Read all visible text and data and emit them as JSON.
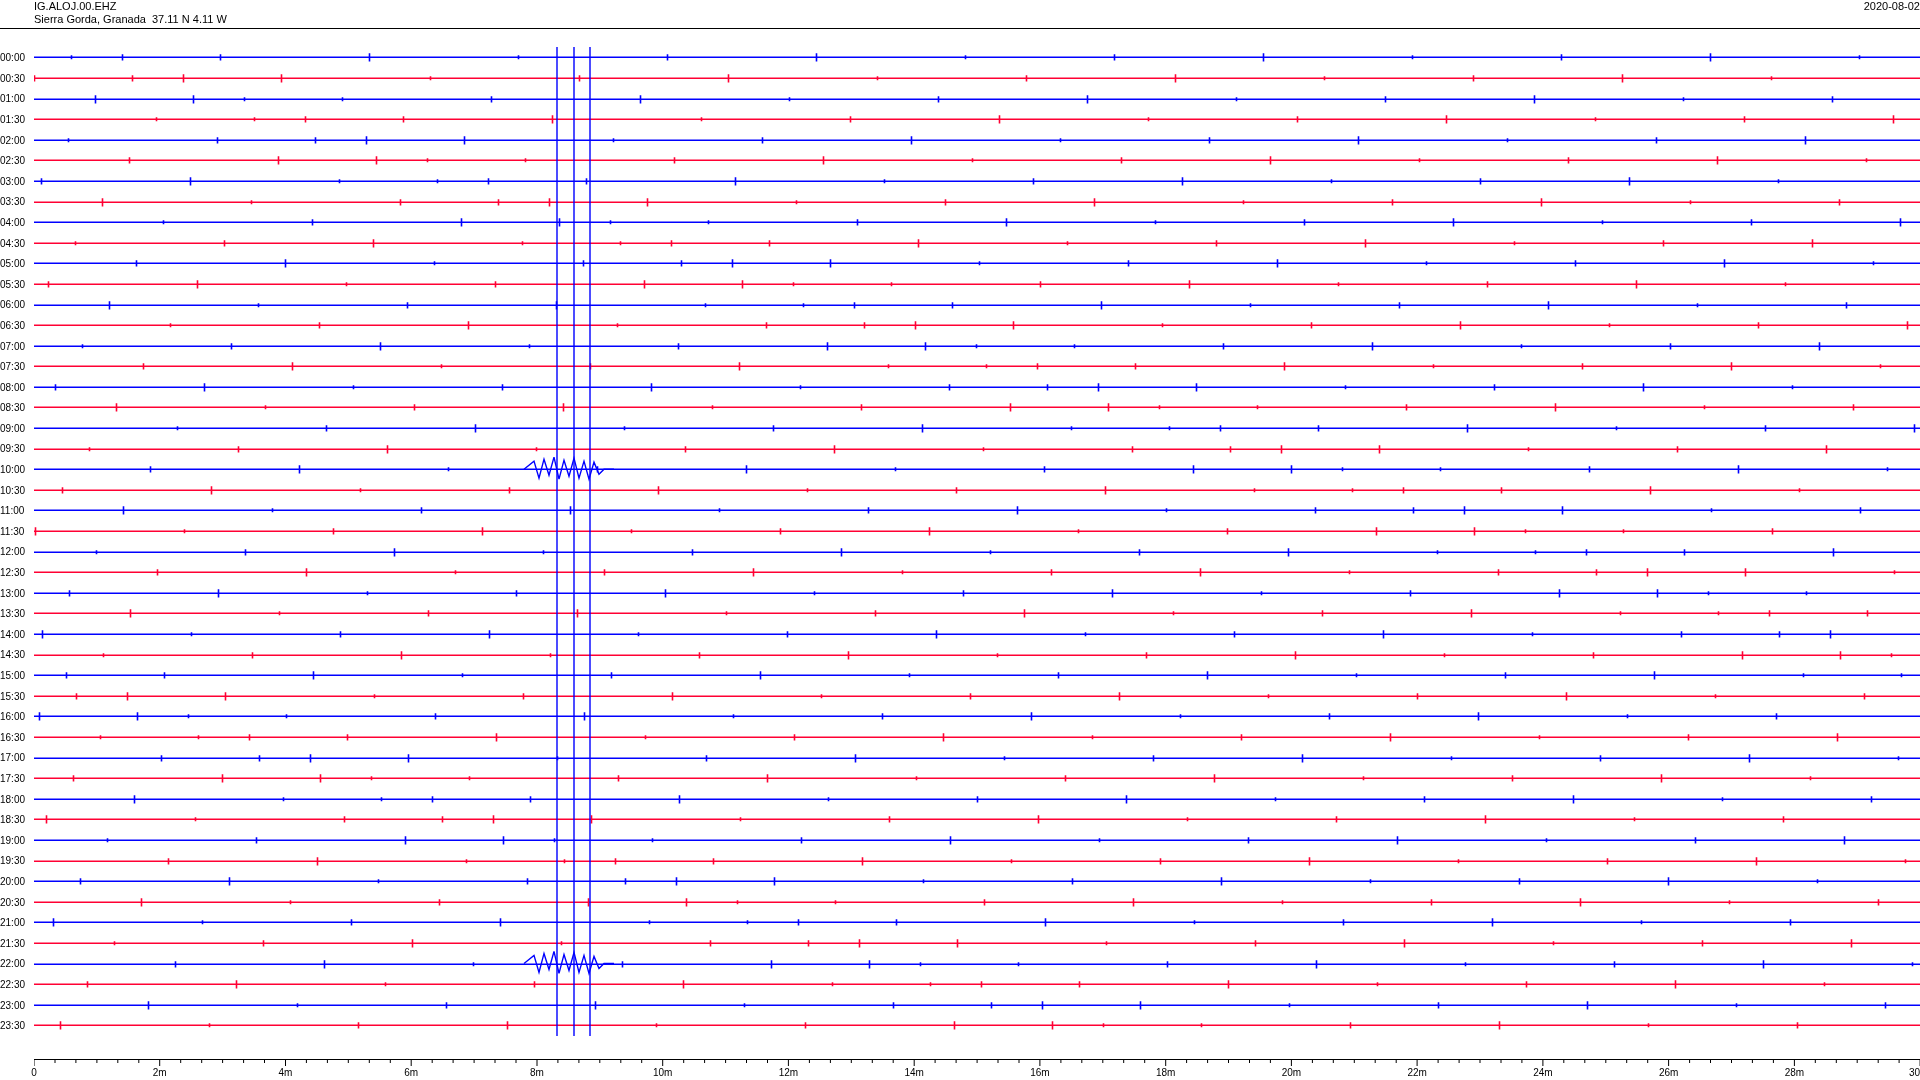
{
  "header": {
    "station": "IG.ALOJ.00.EHZ",
    "location": "Sierra Gorda, Granada  37.11 N 4.11 W",
    "date": "2020-08-02"
  },
  "rows": [
    {
      "label": "00:00",
      "color": "#0000ff"
    },
    {
      "label": "00:30",
      "color": "#ff0033"
    },
    {
      "label": "01:00",
      "color": "#0000ff"
    },
    {
      "label": "01:30",
      "color": "#ff0033"
    },
    {
      "label": "02:00",
      "color": "#0000ff"
    },
    {
      "label": "02:30",
      "color": "#ff0033"
    },
    {
      "label": "03:00",
      "color": "#0000ff"
    },
    {
      "label": "03:30",
      "color": "#ff0033"
    },
    {
      "label": "04:00",
      "color": "#0000ff"
    },
    {
      "label": "04:30",
      "color": "#ff0033"
    },
    {
      "label": "05:00",
      "color": "#0000ff"
    },
    {
      "label": "05:30",
      "color": "#ff0033"
    },
    {
      "label": "06:00",
      "color": "#0000ff"
    },
    {
      "label": "06:30",
      "color": "#ff0033"
    },
    {
      "label": "07:00",
      "color": "#0000ff"
    },
    {
      "label": "07:30",
      "color": "#ff0033"
    },
    {
      "label": "08:00",
      "color": "#0000ff"
    },
    {
      "label": "08:30",
      "color": "#ff0033"
    },
    {
      "label": "09:00",
      "color": "#0000ff"
    },
    {
      "label": "09:30",
      "color": "#ff0033"
    },
    {
      "label": "10:00",
      "color": "#0000ff"
    },
    {
      "label": "10:30",
      "color": "#ff0033"
    },
    {
      "label": "11:00",
      "color": "#0000ff"
    },
    {
      "label": "11:30",
      "color": "#ff0033"
    },
    {
      "label": "12:00",
      "color": "#0000ff"
    },
    {
      "label": "12:30",
      "color": "#ff0033"
    },
    {
      "label": "13:00",
      "color": "#0000ff"
    },
    {
      "label": "13:30",
      "color": "#ff0033"
    },
    {
      "label": "14:00",
      "color": "#0000ff"
    },
    {
      "label": "14:30",
      "color": "#ff0033"
    },
    {
      "label": "15:00",
      "color": "#0000ff"
    },
    {
      "label": "15:30",
      "color": "#ff0033"
    },
    {
      "label": "16:00",
      "color": "#0000ff"
    },
    {
      "label": "16:30",
      "color": "#ff0033"
    },
    {
      "label": "17:00",
      "color": "#0000ff"
    },
    {
      "label": "17:30",
      "color": "#ff0033"
    },
    {
      "label": "18:00",
      "color": "#0000ff"
    },
    {
      "label": "18:30",
      "color": "#ff0033"
    },
    {
      "label": "19:00",
      "color": "#0000ff"
    },
    {
      "label": "19:30",
      "color": "#ff0033"
    },
    {
      "label": "20:00",
      "color": "#0000ff"
    },
    {
      "label": "20:30",
      "color": "#ff0033"
    },
    {
      "label": "21:00",
      "color": "#0000ff"
    },
    {
      "label": "21:30",
      "color": "#ff0033"
    },
    {
      "label": "22:00",
      "color": "#0000ff"
    },
    {
      "label": "22:30",
      "color": "#ff0033"
    },
    {
      "label": "23:00",
      "color": "#0000ff"
    },
    {
      "label": "23:30",
      "color": "#ff0033"
    }
  ],
  "x_axis": {
    "ticks": [
      "0",
      "2m",
      "4m",
      "6m",
      "8m",
      "10m",
      "12m",
      "14m",
      "16m",
      "18m",
      "20m",
      "22m",
      "24m",
      "26m",
      "28m",
      "30"
    ]
  }
}
